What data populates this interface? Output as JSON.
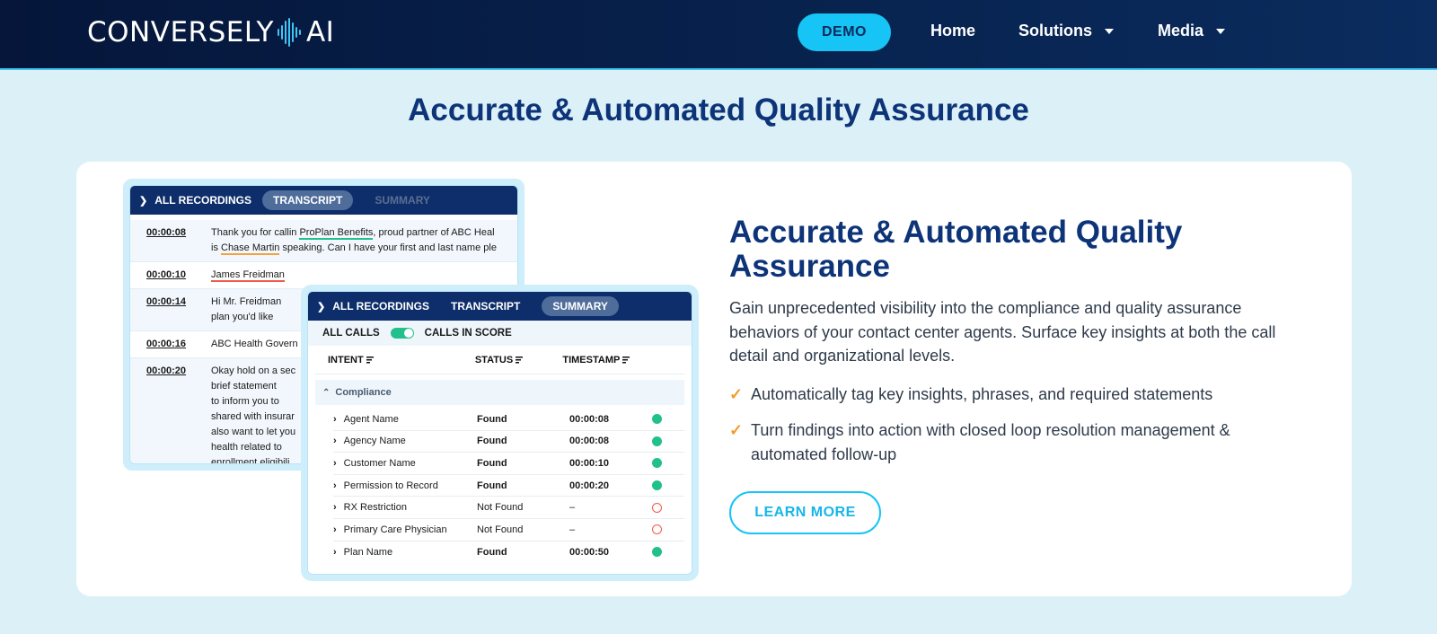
{
  "nav": {
    "logo_text_left": "CONVERSELY",
    "logo_text_right": "AI",
    "demo_label": "DEMO",
    "home_label": "Home",
    "solutions_label": "Solutions",
    "media_label": "Media"
  },
  "page_title": "Accurate & Automated Quality Assurance",
  "transcript_panel": {
    "tab_all": "ALL RECORDINGS",
    "tab_transcript": "TRANSCRIPT",
    "tab_summary": "SUMMARY",
    "rows": [
      {
        "time": "00:00:08",
        "pre": "Thank you for callin ",
        "hl1": "ProPlan Benefits",
        "mid": ", proud partner of ABC Heal\nis ",
        "hl2": "Chase Martin",
        "post": " speaking. Can I have your first and last name ple"
      },
      {
        "time": "00:00:10",
        "text": "James Freidman"
      },
      {
        "time": "00:00:14",
        "text": "Hi Mr. Freidman\nplan you'd like"
      },
      {
        "time": "00:00:16",
        "text": "ABC Health Govern"
      },
      {
        "time": "00:00:20",
        "text": "Okay hold on a sec\nbrief statement\nto inform you to\nshared with insurar\nalso want to let you\nhealth related to\nenrollment eligibili"
      }
    ]
  },
  "summary_panel": {
    "tab_all": "ALL RECORDINGS",
    "tab_transcript": "TRANSCRIPT",
    "tab_summary": "SUMMARY",
    "filter_all": "ALL CALLS",
    "filter_score": "CALLS IN SCORE",
    "col_intent": "INTENT",
    "col_status": "STATUS",
    "col_timestamp": "TIMESTAMP",
    "group_label": "Compliance",
    "rows": [
      {
        "intent": "Agent Name",
        "status": "Found",
        "timestamp": "00:00:08",
        "found": true
      },
      {
        "intent": "Agency Name",
        "status": "Found",
        "timestamp": "00:00:08",
        "found": true
      },
      {
        "intent": "Customer Name",
        "status": "Found",
        "timestamp": "00:00:10",
        "found": true
      },
      {
        "intent": "Permission to Record",
        "status": "Found",
        "timestamp": "00:00:20",
        "found": true
      },
      {
        "intent": "RX Restriction",
        "status": "Not Found",
        "timestamp": "–",
        "found": false
      },
      {
        "intent": "Primary Care Physician",
        "status": "Not Found",
        "timestamp": "–",
        "found": false
      },
      {
        "intent": "Plan Name",
        "status": "Found",
        "timestamp": "00:00:50",
        "found": true
      }
    ]
  },
  "section": {
    "title": "Accurate & Automated Quality Assurance",
    "description": "Gain unprecedented visibility into the compliance and quality assurance behaviors of your contact center agents. Surface key insights at both the call detail and organizational levels.",
    "bullets": [
      "Automatically tag key insights, phrases, and required statements",
      "Turn findings into action with closed loop resolution management & automated follow-up"
    ],
    "cta_label": "LEARN MORE"
  },
  "colors": {
    "navy": "#0d3478",
    "cyan": "#16c4f5",
    "found": "#22c08b",
    "missing": "#f05a4a",
    "check": "#f29d2b"
  }
}
